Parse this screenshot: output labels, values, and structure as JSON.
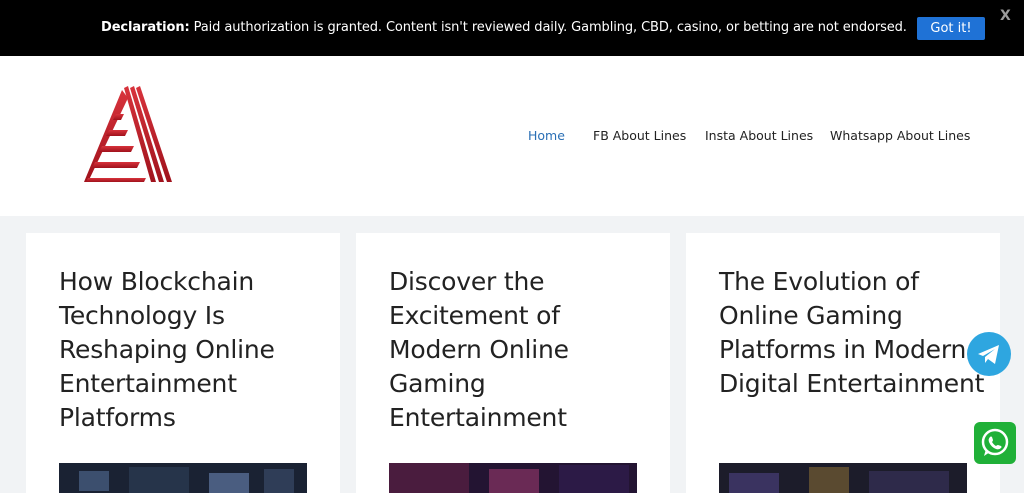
{
  "notice": {
    "label": "Declaration:",
    "text": " Paid authorization is granted. Content isn't reviewed daily. Gambling, CBD, casino, or betting are not endorsed.",
    "button_label": "Got it!",
    "close_label": "X"
  },
  "nav": {
    "items": [
      {
        "label": "Home",
        "active": true
      },
      {
        "label": "FB About Lines",
        "active": false
      },
      {
        "label": "Insta About Lines",
        "active": false
      },
      {
        "label": "Whatsapp About Lines",
        "active": false
      }
    ]
  },
  "posts": [
    {
      "title": "How Blockchain Technology Is Reshaping Online Entertainment Platforms"
    },
    {
      "title": "Discover the Excitement of Modern Online Gaming Entertainment"
    },
    {
      "title": "The Evolution of Online Gaming Platforms in Modern Digital Entertainment"
    }
  ],
  "colors": {
    "accent": "#2a6fb5",
    "button": "#1f72d6",
    "logo_red": "#c0202a",
    "telegram": "#2ea6e0",
    "whatsapp": "#20b038"
  },
  "icons": {
    "logo": "triangle-logo",
    "telegram": "telegram-icon",
    "whatsapp": "whatsapp-icon"
  }
}
